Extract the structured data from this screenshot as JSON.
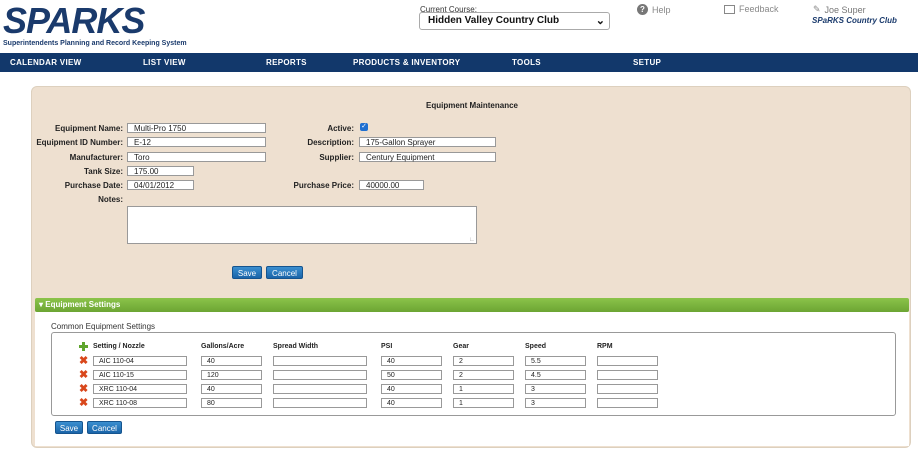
{
  "header": {
    "logo_text": "SPARKS",
    "logo_tagline": "Superintendents Planning and Record Keeping System",
    "course_label": "Current Course:",
    "course_value": "Hidden Valley Country Club",
    "help_label": "Help",
    "feedback_label": "Feedback",
    "user_name": "Joe Super",
    "club_name": "SPaRKS Country Club"
  },
  "nav": [
    "CALENDAR VIEW",
    "LIST VIEW",
    "REPORTS",
    "PRODUCTS & INVENTORY",
    "TOOLS",
    "SETUP"
  ],
  "form": {
    "title": "Equipment Maintenance",
    "equipment_name_label": "Equipment Name:",
    "equipment_name": "Multi-Pro 1750",
    "equipment_id_label": "Equipment ID Number:",
    "equipment_id": "E-12",
    "manufacturer_label": "Manufacturer:",
    "manufacturer": "Toro",
    "tank_size_label": "Tank Size:",
    "tank_size": "175.00",
    "purchase_date_label": "Purchase Date:",
    "purchase_date": "04/01/2012",
    "notes_label": "Notes:",
    "active_label": "Active:",
    "active_checked": true,
    "description_label": "Description:",
    "description": "175-Gallon Sprayer",
    "supplier_label": "Supplier:",
    "supplier": "Century Equipment",
    "purchase_price_label": "Purchase Price:",
    "purchase_price": "40000.00",
    "save_label": "Save",
    "cancel_label": "Cancel"
  },
  "settings": {
    "section_title": "Equipment Settings",
    "common_label": "Common Equipment Settings",
    "columns": [
      "Setting / Nozzle",
      "Gallons/Acre",
      "Spread Width",
      "PSI",
      "Gear",
      "Speed",
      "RPM"
    ],
    "rows": [
      [
        "AIC 110-04",
        "40",
        "",
        "40",
        "2",
        "5.5",
        ""
      ],
      [
        "AIC 110-15",
        "120",
        "",
        "50",
        "2",
        "4.5",
        ""
      ],
      [
        "XRC 110-04",
        "40",
        "",
        "40",
        "1",
        "3",
        ""
      ],
      [
        "XRC 110-08",
        "80",
        "",
        "40",
        "1",
        "3",
        ""
      ]
    ],
    "save_label": "Save",
    "cancel_label": "Cancel"
  },
  "colors": {
    "nav_bg": "#12386b",
    "panel_bg": "#eee0d0",
    "settings_bar": "#7ab33e",
    "button": "#2478bd",
    "delete_icon": "#d9471b",
    "add_icon": "#5fa52d"
  }
}
